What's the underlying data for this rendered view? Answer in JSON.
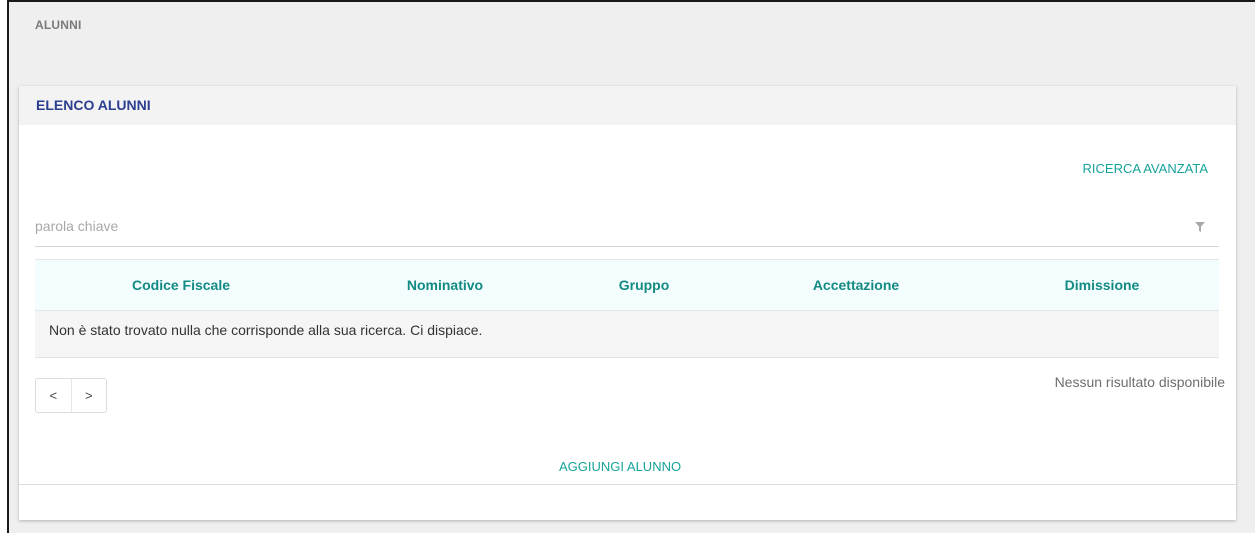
{
  "page": {
    "title": "ALUNNI"
  },
  "card": {
    "title": "ELENCO ALUNNI",
    "advanced_search_label": "RICERCA AVANZATA"
  },
  "search": {
    "value": "",
    "placeholder": "parola chiave",
    "icon": "filter-icon"
  },
  "table": {
    "columns": [
      "Codice Fiscale",
      "Nominativo",
      "Gruppo",
      "Accettazione",
      "Dimissione"
    ],
    "empty_message": "Non è stato trovato nulla che corrisponde alla sua ricerca. Ci dispiace."
  },
  "pagination": {
    "prev_label": "<",
    "next_label": ">",
    "result_text": "Nessun risultato disponibile"
  },
  "actions": {
    "add_label": "AGGIUNGI ALUNNO"
  },
  "colors": {
    "accent": "#17a39a",
    "title_blue": "#2c3e8f",
    "header_bg": "#f3fdfe"
  }
}
